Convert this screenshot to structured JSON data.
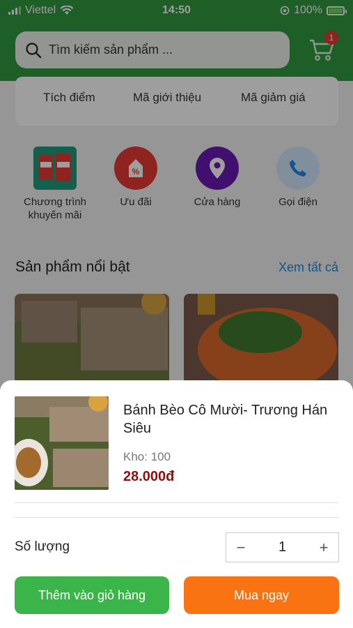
{
  "status_bar": {
    "carrier": "Viettel",
    "time": "14:50",
    "battery": "100%"
  },
  "header": {
    "search_placeholder": "Tìm kiếm sản phẩm ...",
    "cart_count": "1"
  },
  "top_card": {
    "items": [
      "Tích điểm",
      "Mã giới thiệu",
      "Mã giảm giá"
    ]
  },
  "quick_actions": [
    {
      "label": "Chương trình khuyến mãi",
      "icon": "promotion-icon"
    },
    {
      "label": "Ưu đãi",
      "icon": "discount-tag-icon",
      "color": "#e53935"
    },
    {
      "label": "Cửa hàng",
      "icon": "location-pin-icon",
      "color": "#6a1bb3"
    },
    {
      "label": "Gọi điện",
      "icon": "phone-icon",
      "color": "#cfe7fb"
    }
  ],
  "featured": {
    "title": "Sản phẩm nổi bật",
    "see_all": "Xem tất cả"
  },
  "sheet": {
    "product_name": "Bánh Bèo Cô Mười-  Trương Hán Siêu",
    "stock": "Kho: 100",
    "price": "28.000đ",
    "quantity_label": "Số lượng",
    "quantity": "1",
    "minus": "−",
    "plus": "+",
    "add_to_cart": "Thêm vào giỏ hàng",
    "buy_now": "Mua ngay"
  },
  "colors": {
    "header": "#2f9a3f",
    "price": "#8b1111",
    "add_button": "#3bb54a",
    "buy_button": "#f97312"
  }
}
